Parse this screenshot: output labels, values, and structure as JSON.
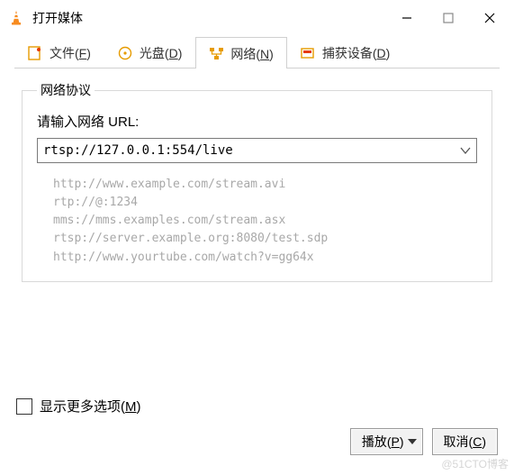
{
  "window": {
    "title": "打开媒体"
  },
  "tabs": {
    "file": {
      "label": "文件",
      "hotkey": "F"
    },
    "disc": {
      "label": "光盘",
      "hotkey": "D"
    },
    "network": {
      "label": "网络",
      "hotkey": "N"
    },
    "capture": {
      "label": "捕获设备",
      "hotkey": "D"
    }
  },
  "network": {
    "group_legend": "网络协议",
    "prompt": "请输入网络 URL:",
    "url_value": "rtsp://127.0.0.1:554/live",
    "examples": "http://www.example.com/stream.avi\nrtp://@:1234\nmms://mms.examples.com/stream.asx\nrtsp://server.example.org:8080/test.sdp\nhttp://www.yourtube.com/watch?v=gg64x"
  },
  "footer": {
    "more_options": {
      "label": "显示更多选项",
      "hotkey": "M"
    },
    "play": {
      "label": "播放",
      "hotkey": "P"
    },
    "cancel": {
      "label": "取消",
      "hotkey": "C"
    }
  },
  "watermark": "@51CTO博客"
}
